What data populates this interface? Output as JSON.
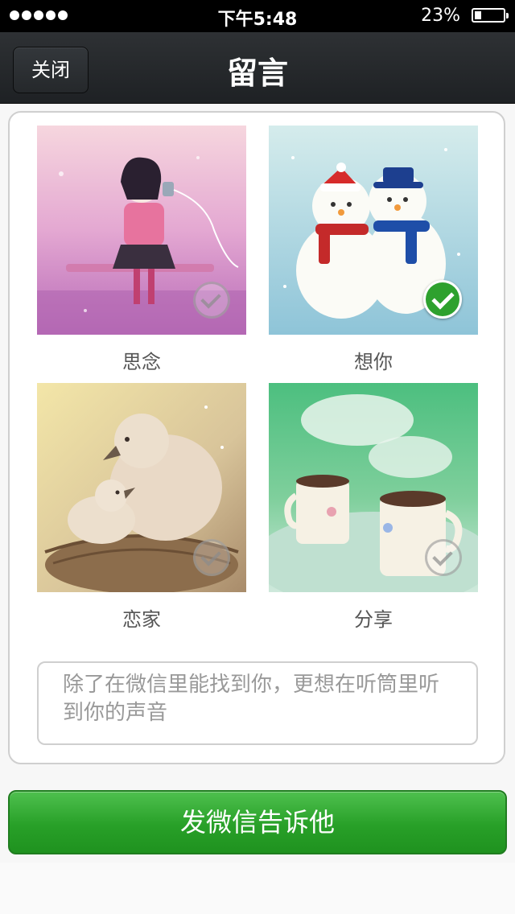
{
  "status_bar": {
    "time": "下午5:48",
    "battery": "23%",
    "battery_level": 0.23
  },
  "nav": {
    "close_label": "关闭",
    "title": "留言"
  },
  "cards": [
    {
      "caption": "思念",
      "image": "girl-with-tin-can-phone",
      "selected": false
    },
    {
      "caption": "想你",
      "image": "two-snowmen",
      "selected": true
    },
    {
      "caption": "恋家",
      "image": "birds-in-nest",
      "selected": false
    },
    {
      "caption": "分享",
      "image": "two-coffee-cups",
      "selected": false
    }
  ],
  "message": {
    "text": "除了在微信里能找到你，更想在听筒里听到你的声音"
  },
  "send_button": {
    "label": "发微信告诉他"
  },
  "colors": {
    "accent_green": "#2ea12e",
    "nav_bg": "#25282b"
  }
}
